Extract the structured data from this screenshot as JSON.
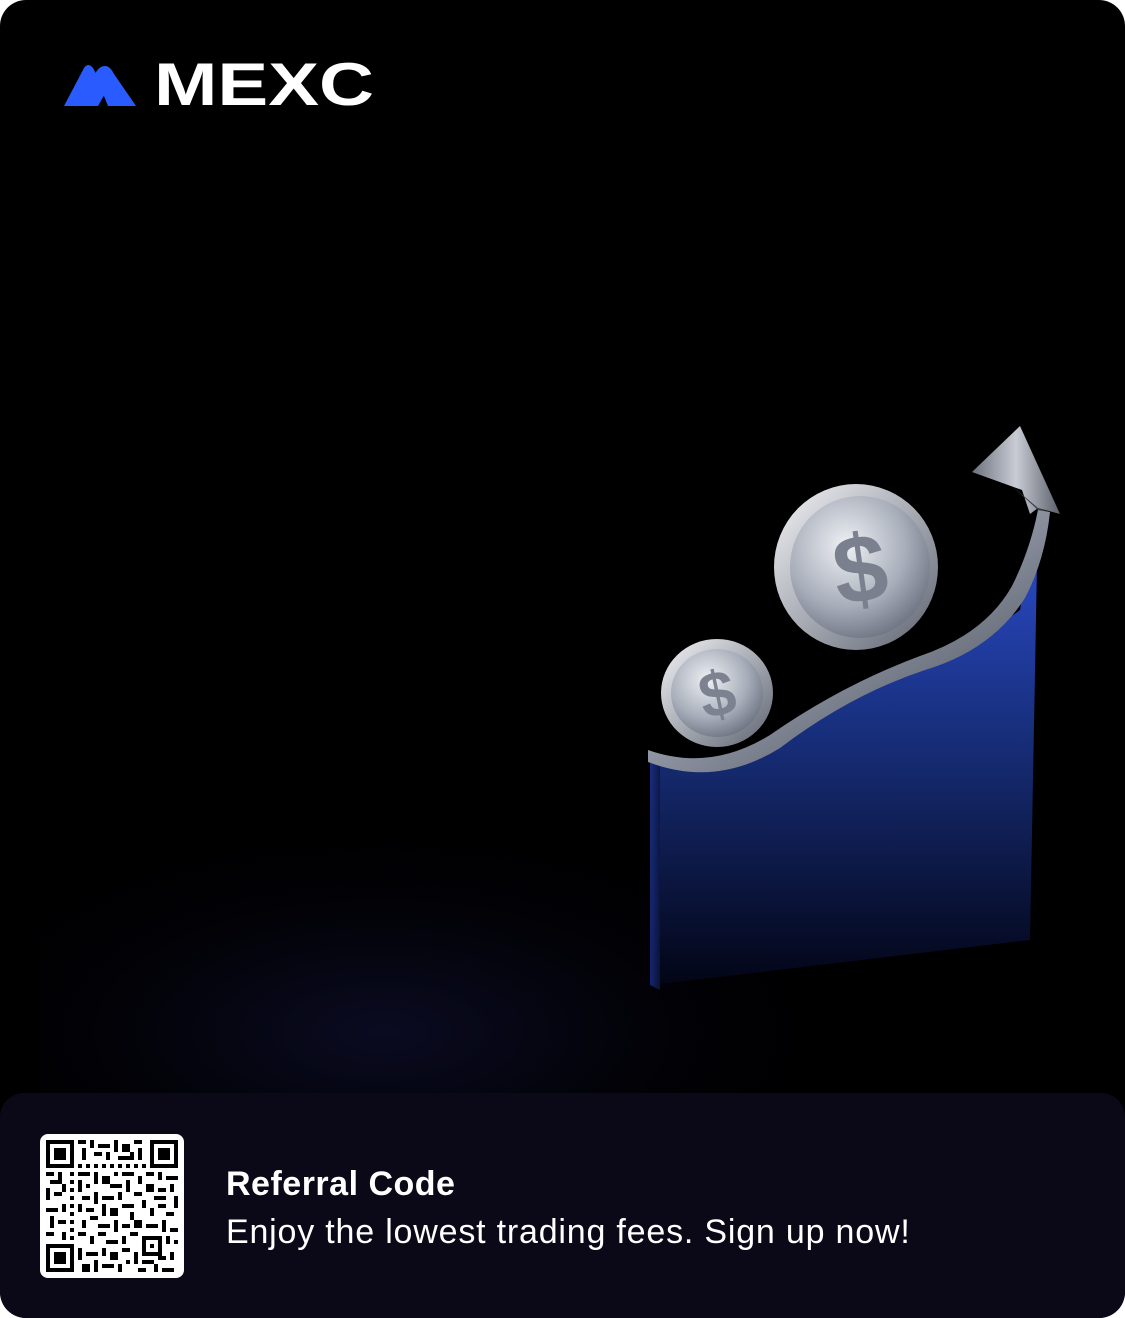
{
  "brand": {
    "name": "MEXC",
    "mark_color": "#2a5bff",
    "text_color": "#ffffff"
  },
  "hero": {
    "icon": "rising-chart-with-dollar-coins",
    "coin_symbol": "$",
    "accent_color": "#2546c8"
  },
  "footer": {
    "title": "Referral Code",
    "subtitle": "Enjoy the lowest trading fees. Sign up now!",
    "qr_icon": "qr-code-icon",
    "background": "#0b0817"
  }
}
